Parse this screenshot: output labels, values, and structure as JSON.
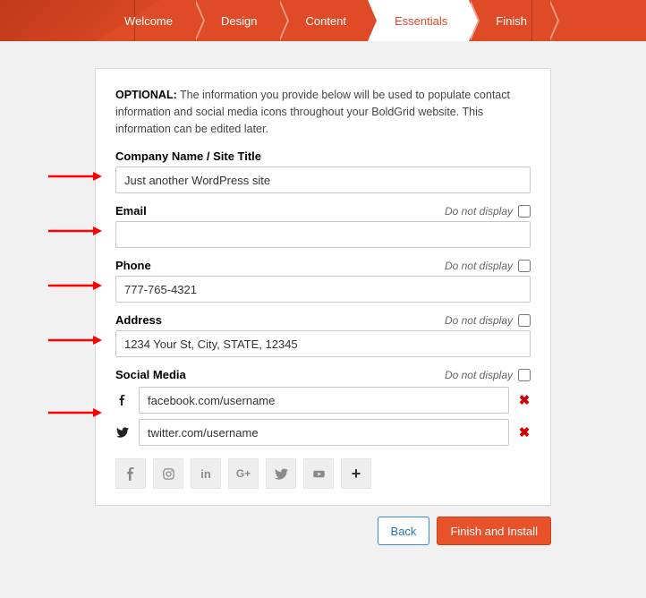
{
  "steps": {
    "s0": "Welcome",
    "s1": "Design",
    "s2": "Content",
    "s3": "Essentials",
    "s4": "Finish"
  },
  "intro": {
    "bold": "OPTIONAL:",
    "text": " The information you provide below will be used to populate contact information and social media icons throughout your BoldGrid website. This information can be edited later."
  },
  "labels": {
    "company": "Company Name / Site Title",
    "email": "Email",
    "phone": "Phone",
    "address": "Address",
    "social": "Social Media",
    "dnd": "Do not display"
  },
  "values": {
    "company": "Just another WordPress site",
    "email": "",
    "phone": "777-765-4321",
    "address": "1234 Your St, City, STATE, 12345",
    "fb": "facebook.com/username",
    "tw": "twitter.com/username"
  },
  "buttons": {
    "back": "Back",
    "finish": "Finish and Install"
  }
}
